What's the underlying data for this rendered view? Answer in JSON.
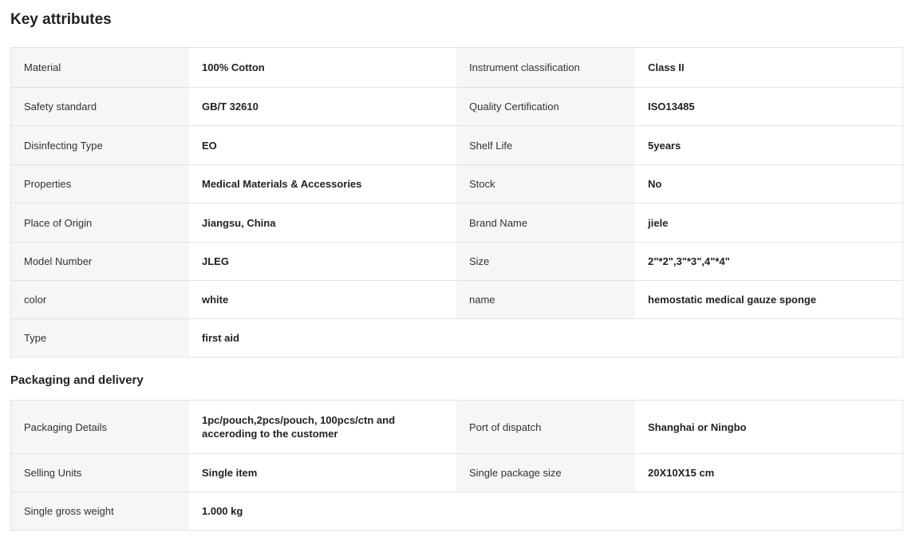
{
  "key_attributes": {
    "title": "Key attributes",
    "rows": [
      [
        {
          "label": "Material",
          "value": "100% Cotton"
        },
        {
          "label": "Instrument classification",
          "value": "Class II"
        }
      ],
      [
        {
          "label": "Safety standard",
          "value": "GB/T 32610"
        },
        {
          "label": "Quality Certification",
          "value": "ISO13485"
        }
      ],
      [
        {
          "label": "Disinfecting Type",
          "value": "EO"
        },
        {
          "label": "Shelf Life",
          "value": "5years"
        }
      ],
      [
        {
          "label": "Properties",
          "value": "Medical Materials & Accessories"
        },
        {
          "label": "Stock",
          "value": "No"
        }
      ],
      [
        {
          "label": "Place of Origin",
          "value": "Jiangsu, China"
        },
        {
          "label": "Brand Name",
          "value": "jiele"
        }
      ],
      [
        {
          "label": "Model Number",
          "value": "JLEG"
        },
        {
          "label": "Size",
          "value": "2\"*2\",3\"*3\",4\"*4\""
        }
      ],
      [
        {
          "label": "color",
          "value": "white"
        },
        {
          "label": "name",
          "value": "hemostatic medical gauze sponge"
        }
      ],
      [
        {
          "label": "Type",
          "value": "first aid"
        }
      ]
    ]
  },
  "packaging": {
    "title": "Packaging and delivery",
    "rows": [
      [
        {
          "label": "Packaging Details",
          "value": "1pc/pouch,2pcs/pouch, 100pcs/ctn and acceroding to the customer"
        },
        {
          "label": "Port of dispatch",
          "value": "Shanghai or Ningbo"
        }
      ],
      [
        {
          "label": "Selling Units",
          "value": "Single item"
        },
        {
          "label": "Single package size",
          "value": "20X10X15 cm"
        }
      ],
      [
        {
          "label": "Single gross weight",
          "value": "1.000 kg"
        }
      ]
    ]
  }
}
